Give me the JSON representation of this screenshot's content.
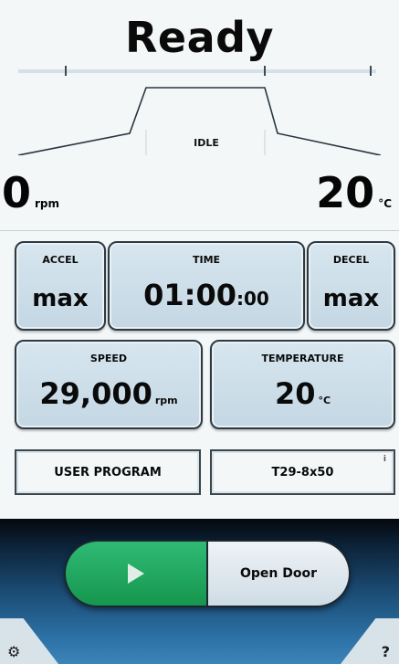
{
  "status": {
    "title": "Ready",
    "state_label": "IDLE"
  },
  "readout": {
    "speed_value": "0",
    "speed_unit": "rpm",
    "temp_value": "20",
    "temp_unit": "°C"
  },
  "params": {
    "accel": {
      "label": "ACCEL",
      "value": "max"
    },
    "time": {
      "label": "TIME",
      "value_main": "01:00",
      "value_seconds": ":00"
    },
    "decel": {
      "label": "DECEL",
      "value": "max"
    },
    "speed": {
      "label": "SPEED",
      "value": "29,000",
      "unit": "rpm"
    },
    "temperature": {
      "label": "TEMPERATURE",
      "value": "20",
      "unit": "°C"
    }
  },
  "program": {
    "user_program_label": "USER PROGRAM",
    "rotor_label": "T29-8x50",
    "info_mark": "i"
  },
  "controls": {
    "start_icon": "play-icon",
    "open_door_label": "Open Door",
    "settings_icon": "gears-icon",
    "help_label": "?"
  },
  "colors": {
    "start_green": "#1fa860",
    "tile_blue": "#cddfe9",
    "panel_dark_blue": "#1b4b73"
  }
}
